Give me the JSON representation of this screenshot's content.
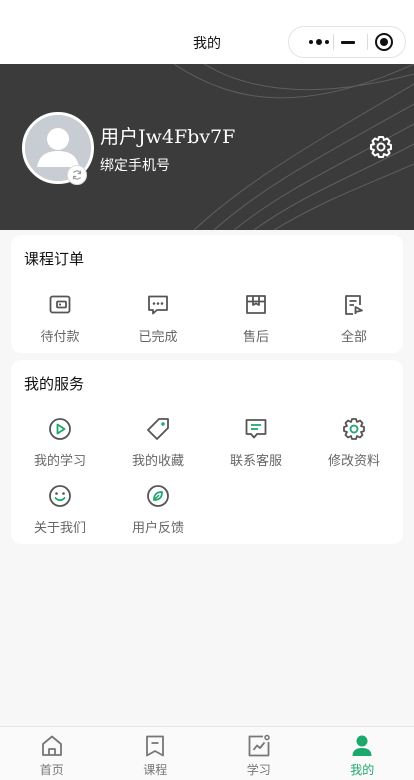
{
  "navbar": {
    "title": "我的",
    "capsule": {
      "more_icon": "more-dots-icon",
      "minimize_icon": "minimize-icon",
      "close_icon": "target-close-icon"
    }
  },
  "profile": {
    "username": "用户Jw4Fbv7F",
    "bind_phone_label": "绑定手机号",
    "avatar_icon": "user-avatar-icon",
    "avatar_badge_icon": "refresh-icon",
    "settings_icon": "gear-icon"
  },
  "orders": {
    "title": "课程订单",
    "items": [
      {
        "label": "待付款",
        "icon": "wallet-icon"
      },
      {
        "label": "已完成",
        "icon": "chat-dots-icon"
      },
      {
        "label": "售后",
        "icon": "shop-box-icon"
      },
      {
        "label": "全部",
        "icon": "document-list-icon"
      }
    ]
  },
  "services": {
    "title": "我的服务",
    "items": [
      {
        "label": "我的学习",
        "icon": "play-circle-icon"
      },
      {
        "label": "我的收藏",
        "icon": "tag-icon"
      },
      {
        "label": "联系客服",
        "icon": "message-icon"
      },
      {
        "label": "修改资料",
        "icon": "gear-icon"
      },
      {
        "label": "关于我们",
        "icon": "smile-icon"
      },
      {
        "label": "用户反馈",
        "icon": "compass-leaf-icon"
      }
    ]
  },
  "tabbar": {
    "active_index": 3,
    "items": [
      {
        "label": "首页",
        "icon": "home-icon"
      },
      {
        "label": "课程",
        "icon": "bookmark-icon"
      },
      {
        "label": "学习",
        "icon": "chart-icon"
      },
      {
        "label": "我的",
        "icon": "user-icon"
      }
    ]
  },
  "colors": {
    "accent_green": "#1ca86b",
    "header_dark": "#3b3b3b",
    "icon_gray": "#555555",
    "page_background": "#f7f7f7"
  }
}
